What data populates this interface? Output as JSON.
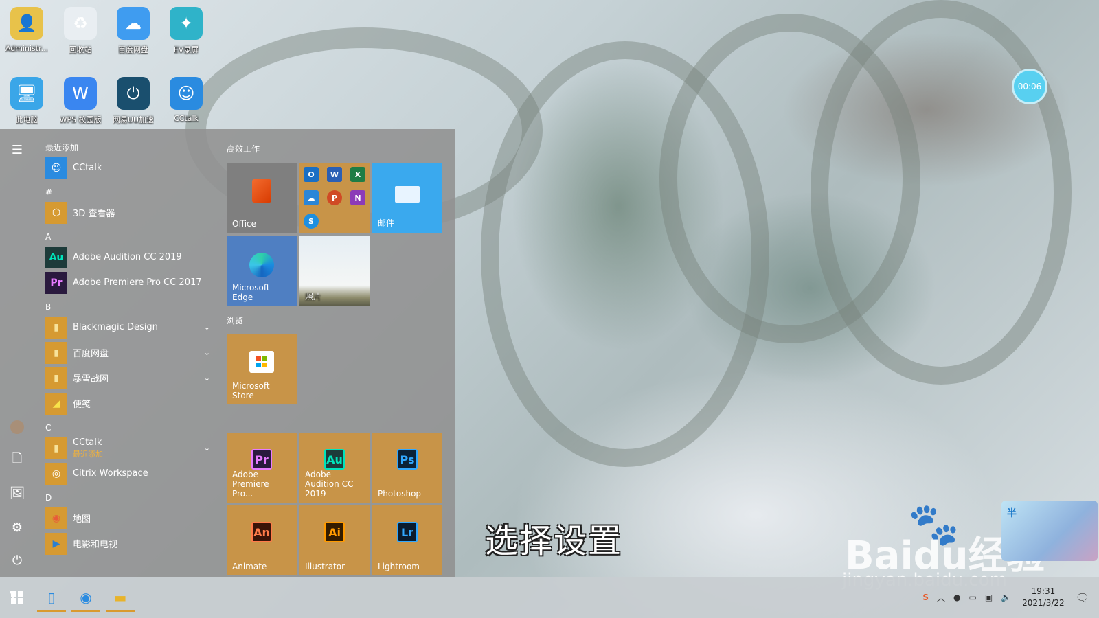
{
  "desktop": {
    "icons": [
      {
        "label": "Administr...",
        "icon": "user-folder-icon",
        "glyph": "👤",
        "color": "#e8c24a"
      },
      {
        "label": "回收站",
        "icon": "recycle-bin-icon",
        "glyph": "♻",
        "color": "#e9eef2"
      },
      {
        "label": "百度网盘",
        "icon": "baidu-netdisk-icon",
        "glyph": "☁",
        "color": "#3f9cf0"
      },
      {
        "label": "EV录屏",
        "icon": "ev-recorder-icon",
        "glyph": "✦",
        "color": "#2fb3c9"
      },
      {
        "label": "此电脑",
        "icon": "this-pc-icon",
        "glyph": "🖥",
        "color": "#3aa6e8"
      },
      {
        "label": "WPS 校园版",
        "icon": "wps-icon",
        "glyph": "W",
        "color": "#3a86f0"
      },
      {
        "label": "网易UU加速",
        "icon": "uu-booster-icon",
        "glyph": "⏻",
        "color": "#1a4f6e"
      },
      {
        "label": "CCtalk",
        "icon": "cctalk-icon",
        "glyph": "☺",
        "color": "#2a8be0"
      }
    ]
  },
  "start_menu": {
    "rail": {
      "menu": "☰",
      "avatar": "●",
      "documents": "🗋",
      "pictures": "🖼",
      "settings": "⚙",
      "power": "⏻"
    },
    "recent_title": "最近添加",
    "recent": [
      {
        "label": "CCtalk",
        "icon": "cctalk-icon",
        "glyph": "☺",
        "color": "#2a8be0"
      }
    ],
    "groups": [
      {
        "letter": "#",
        "apps": [
          {
            "label": "3D 查看器",
            "icon": "3d-viewer-icon",
            "glyph": "⬡",
            "color": "#d69a32",
            "fg": "#fff"
          }
        ]
      },
      {
        "letter": "A",
        "apps": [
          {
            "label": "Adobe Audition CC 2019",
            "icon": "audition-icon",
            "glyph": "Au",
            "color": "#1d3b3a",
            "fg": "#00e4bb"
          },
          {
            "label": "Adobe Premiere Pro CC 2017",
            "icon": "premiere-icon",
            "glyph": "Pr",
            "color": "#2a1a3e",
            "fg": "#e77bff"
          }
        ]
      },
      {
        "letter": "B",
        "apps": [
          {
            "label": "Blackmagic Design",
            "icon": "folder-icon",
            "glyph": "▮",
            "color": "#d69a32",
            "fg": "#f7e29a",
            "chevron": "⌄"
          },
          {
            "label": "百度网盘",
            "icon": "folder-icon",
            "glyph": "▮",
            "color": "#d69a32",
            "fg": "#f7e29a",
            "chevron": "⌄"
          },
          {
            "label": "暴雪战网",
            "icon": "folder-icon",
            "glyph": "▮",
            "color": "#d69a32",
            "fg": "#f7e29a",
            "chevron": "⌄"
          },
          {
            "label": "便笺",
            "icon": "sticky-notes-icon",
            "glyph": "◢",
            "color": "#d69a32",
            "fg": "#f8e34a"
          }
        ]
      },
      {
        "letter": "C",
        "apps": [
          {
            "label": "CCtalk",
            "sub": "最近添加",
            "icon": "folder-icon",
            "glyph": "▮",
            "color": "#d69a32",
            "fg": "#f7e29a",
            "chevron": "⌄"
          },
          {
            "label": "Citrix Workspace",
            "icon": "citrix-icon",
            "glyph": "◎",
            "color": "#d69a32",
            "fg": "#fff"
          }
        ]
      },
      {
        "letter": "D",
        "apps": [
          {
            "label": "地图",
            "icon": "maps-icon",
            "glyph": "◉",
            "color": "#d69a32",
            "fg": "#e85a3a"
          },
          {
            "label": "电影和电视",
            "icon": "movies-icon",
            "glyph": "▶",
            "color": "#d69a32",
            "fg": "#2a7fd0"
          }
        ]
      }
    ],
    "tile_groups": {
      "productivity": "高效工作",
      "browse": "浏览"
    },
    "tiles": {
      "office": "Office",
      "mail": "邮件",
      "edge": "Microsoft Edge",
      "photos": "照片",
      "store": "Microsoft Store",
      "premiere": "Adobe Premiere Pro...",
      "audition": "Adobe Audition CC 2019",
      "photoshop": "Photoshop",
      "animate": "Animate",
      "illustrator": "Illustrator",
      "lightroom": "Lightroom"
    },
    "adobe_glyphs": {
      "premiere": "Pr",
      "audition": "Au",
      "photoshop": "Ps",
      "animate": "An",
      "illustrator": "Ai",
      "lightroom": "Lr"
    }
  },
  "overlay": {
    "timer": "00:06",
    "subtitle": "选择设置",
    "watermark": "Baidu经验",
    "watermark_url": "jingyan.baidu.com",
    "widget_text": "半"
  },
  "taskbar": {
    "time": "19:31",
    "date": "2021/3/22"
  },
  "colors": {
    "tile_gold": "#c89448",
    "tile_gray": "#7f7f7f",
    "tile_blue": "#3aa9ee",
    "tile_edge": "#4f7fc2",
    "accent": "#d99a2f"
  }
}
